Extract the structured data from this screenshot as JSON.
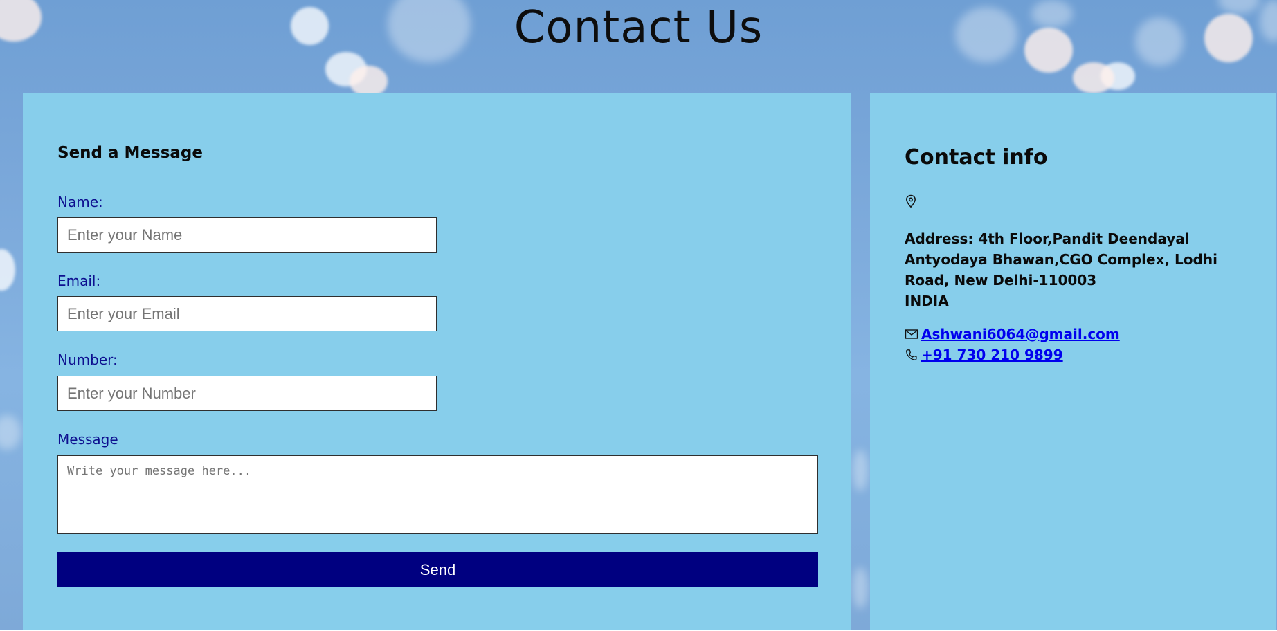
{
  "page": {
    "title": "Contact Us"
  },
  "form": {
    "heading": "Send a Message",
    "name_label": "Name:",
    "name_placeholder": "Enter your Name",
    "email_label": "Email:",
    "email_placeholder": "Enter your Email",
    "number_label": "Number:",
    "number_placeholder": "Enter your Number",
    "message_label": "Message",
    "message_placeholder": "Write your message here...",
    "send_label": "Send"
  },
  "contact_info": {
    "heading": "Contact info",
    "address_line1": "Address: 4th Floor,Pandit Deendayal Antyodaya Bhawan,CGO Complex, Lodhi Road, New Delhi-110003",
    "address_line2": "INDIA",
    "email": "Ashwani6064@gmail.com",
    "phone": "+91 730 210 9899",
    "icons": {
      "location": "map-pin-icon",
      "email": "mail-icon",
      "phone": "phone-icon"
    }
  },
  "colors": {
    "panel_background": "#87ceeb",
    "label_color": "#0d0f8f",
    "button_background": "#000080",
    "link_color": "#0000ee"
  }
}
